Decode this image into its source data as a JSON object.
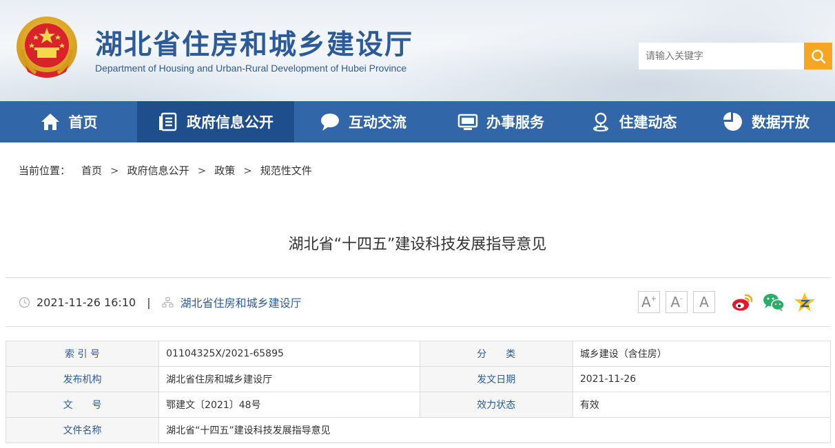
{
  "header": {
    "title": "湖北省住房和城乡建设厅",
    "subtitle": "Department of Housing and Urban-Rural Development of Hubei Province",
    "search_placeholder": "请输入关键字"
  },
  "nav": {
    "items": [
      {
        "label": "首页",
        "icon": "home-icon"
      },
      {
        "label": "政府信息公开",
        "icon": "document-list-icon"
      },
      {
        "label": "互动交流",
        "icon": "chat-bubble-icon"
      },
      {
        "label": "办事服务",
        "icon": "monitor-icon"
      },
      {
        "label": "住建动态",
        "icon": "location-pin-icon"
      },
      {
        "label": "数据开放",
        "icon": "pie-chart-icon"
      }
    ]
  },
  "breadcrumb": {
    "prefix": "当前位置：",
    "items": [
      "首页",
      "政府信息公开",
      "政策",
      "规范性文件"
    ],
    "separator": ">"
  },
  "article": {
    "title": "湖北省“十四五”建设科技发展指导意见",
    "datetime": "2021-11-26 16:10",
    "divider": "|",
    "source": "湖北省住房和城乡建设厅"
  },
  "font_controls": {
    "large": "A",
    "large_sup": "+",
    "medium": "A",
    "medium_sup": "-",
    "default": "A"
  },
  "info_table": {
    "rows": [
      {
        "k1": "索 引 号",
        "v1": "01104325X/2021-65895",
        "k2": "分　　类",
        "v2": "城乡建设（含住房）"
      },
      {
        "k1": "发布机构",
        "v1": "湖北省住房和城乡建设厅",
        "k2": "发文日期",
        "v2": "2021-11-26"
      },
      {
        "k1": "文　　号",
        "v1": "鄂建文〔2021〕48号",
        "k2": "效力状态",
        "v2": "有效"
      },
      {
        "k1": "文件名称",
        "v1": "湖北省“十四五”建设科技发展指导意见"
      }
    ]
  },
  "colors": {
    "nav_bg": "#3166a8",
    "nav_active_bg": "#1e4e8c",
    "brand_blue": "#2d5b99",
    "search_button": "#f5a623"
  }
}
